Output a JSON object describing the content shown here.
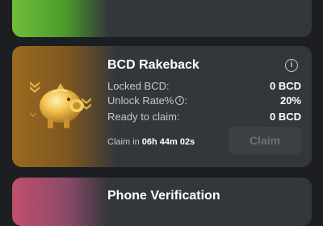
{
  "rakeback": {
    "title": "BCD Rakeback",
    "info_icon": "info-icon",
    "rows": [
      {
        "label": "Locked BCD:",
        "value": "0 BCD"
      },
      {
        "label": "Unlock Rate%",
        "label_suffix": ":",
        "value": "20%"
      },
      {
        "label": "Ready to claim:",
        "value": "0 BCD"
      }
    ],
    "claim_in_label": "Claim in",
    "claim_timer": "06h 44m 02s",
    "claim_button": "Claim"
  },
  "phone": {
    "title": "Phone Verification"
  },
  "colors": {
    "top_card_accent": "#6fbf3a",
    "main_card_accent": "#9b6a1f",
    "bottom_card_accent": "#c0506a",
    "card_bg": "#33363b",
    "page_bg": "#1c1e22"
  }
}
